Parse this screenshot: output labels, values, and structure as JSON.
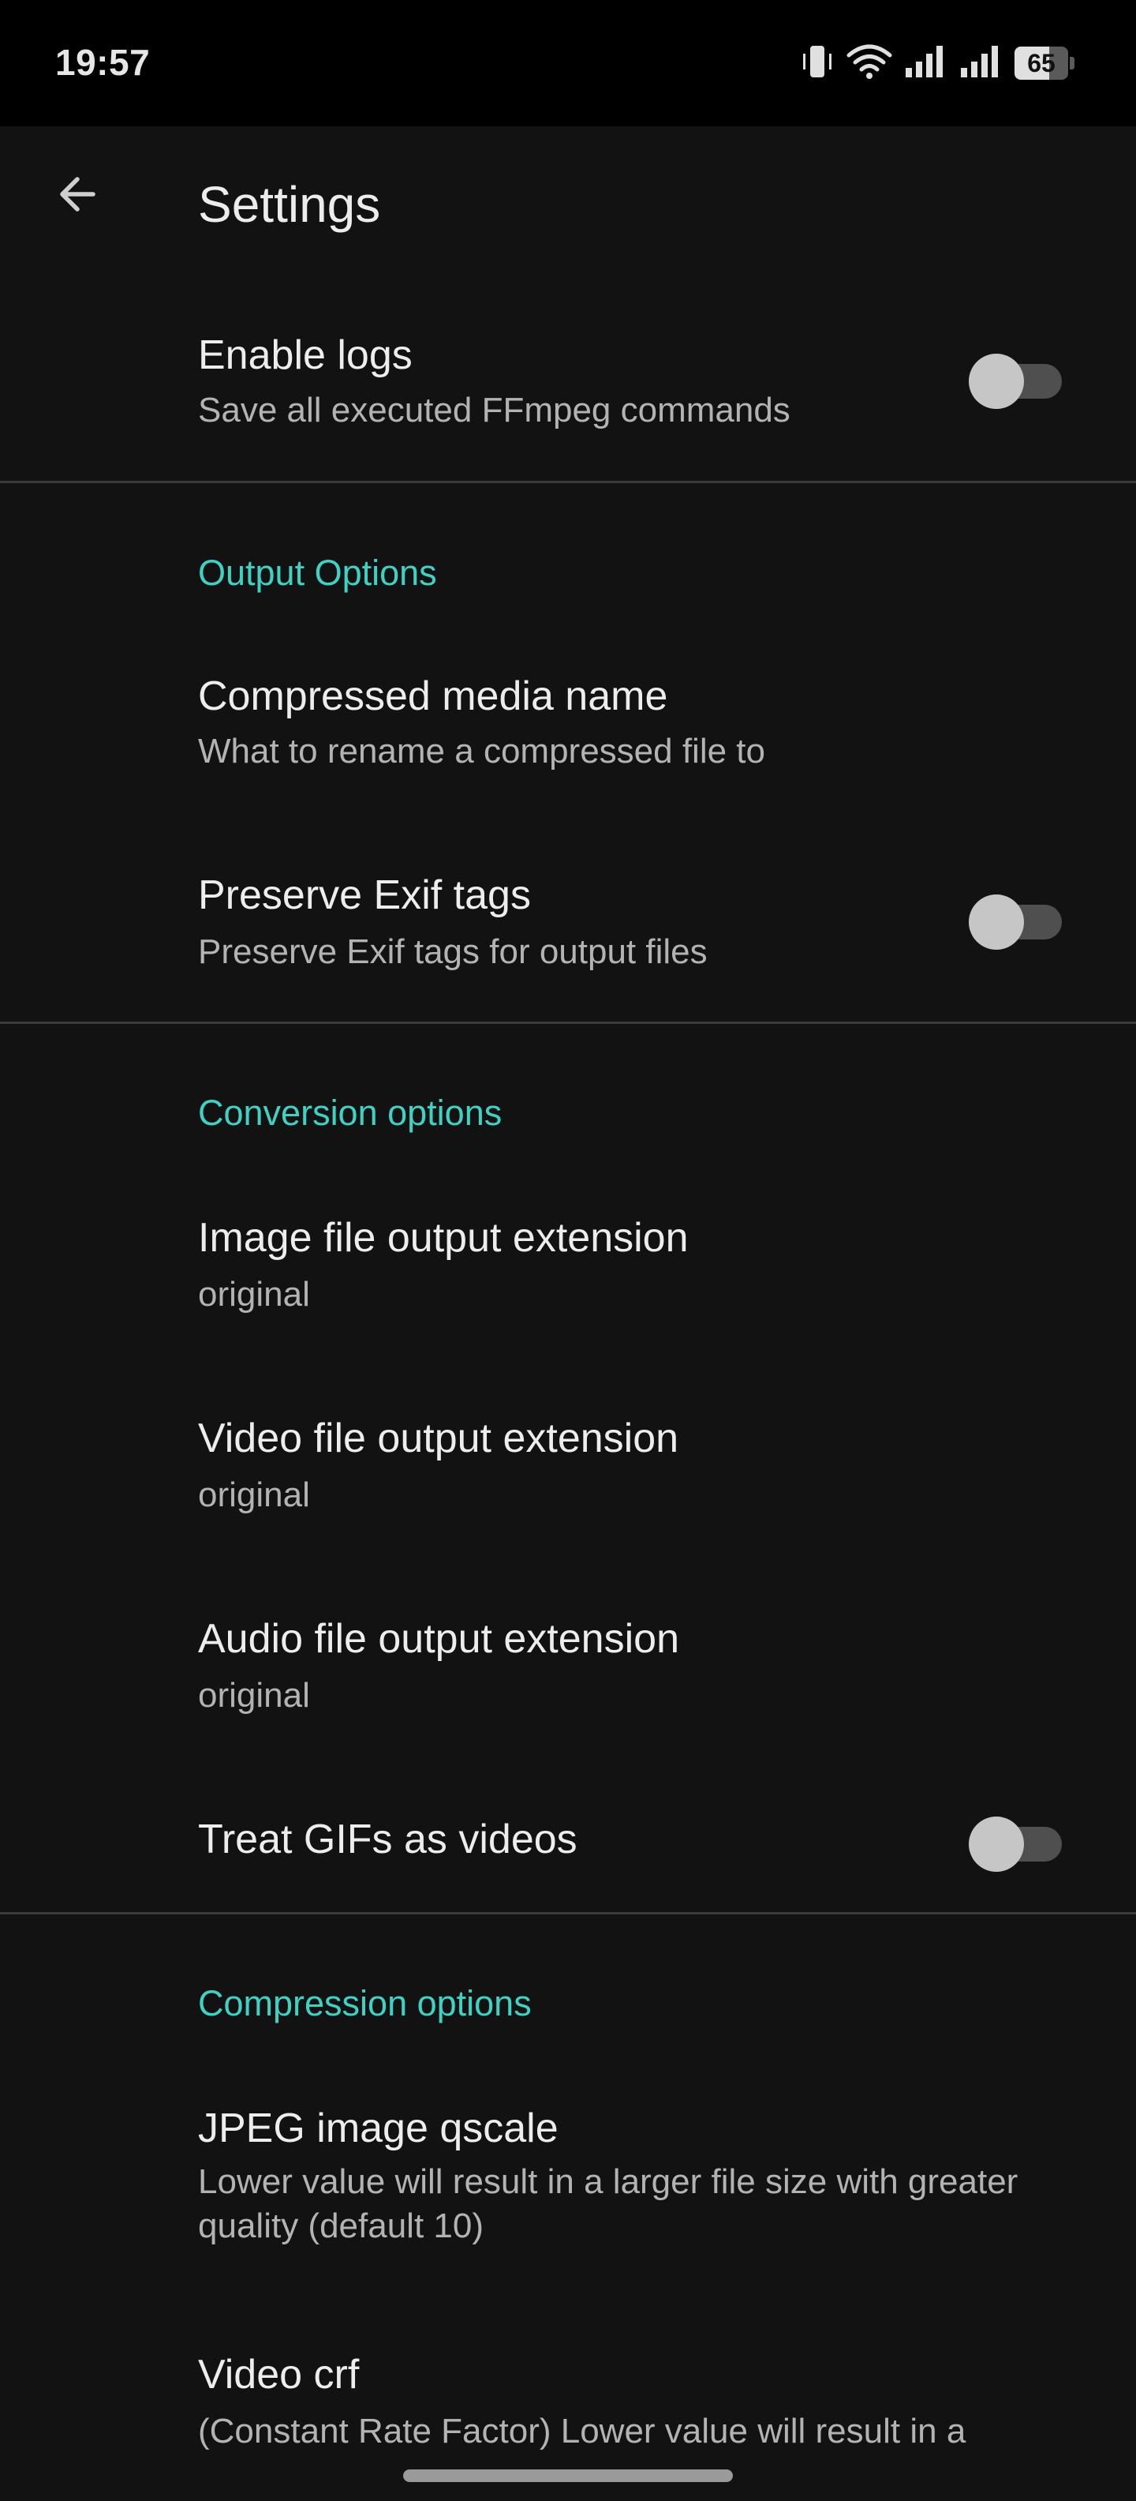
{
  "status_bar": {
    "time": "19:57",
    "battery_level": "65",
    "icons": [
      "vibrate-icon",
      "wifi-icon",
      "signal-icon",
      "signal-icon",
      "battery-icon"
    ]
  },
  "app_bar": {
    "title": "Settings",
    "back_icon": "arrow-left-icon"
  },
  "colors": {
    "background": "#121212",
    "status_bar": "#000000",
    "accent": "#3fd2c4",
    "title_text": "#ededed",
    "summary_text": "#b3b3b3",
    "divider": "#3a3a3a",
    "switch_track_off": "#4f4f4f",
    "switch_thumb_off": "#c6c6c6"
  },
  "preferences": {
    "enable_logs": {
      "title": "Enable logs",
      "summary": "Save all executed FFmpeg commands",
      "enabled": false
    },
    "output_options": {
      "header": "Output Options",
      "compressed_media_name": {
        "title": "Compressed media name",
        "summary": "What to rename a compressed file to"
      },
      "preserve_exif": {
        "title": "Preserve Exif tags",
        "summary": "Preserve Exif tags for output files",
        "enabled": false
      }
    },
    "conversion_options": {
      "header": "Conversion options",
      "image_ext": {
        "title": "Image file output extension",
        "summary": "original"
      },
      "video_ext": {
        "title": "Video file output extension",
        "summary": "original"
      },
      "audio_ext": {
        "title": "Audio file output extension",
        "summary": "original"
      },
      "gifs_as_videos": {
        "title": "Treat GIFs as videos",
        "enabled": false
      }
    },
    "compression_options": {
      "header": "Compression options",
      "jpeg_qscale": {
        "title": "JPEG image qscale",
        "summary": "Lower value will result in a larger file size with greater quality (default 10)"
      },
      "video_crf": {
        "title": "Video crf",
        "summary": "(Constant Rate Factor) Lower value will result in a"
      }
    }
  }
}
